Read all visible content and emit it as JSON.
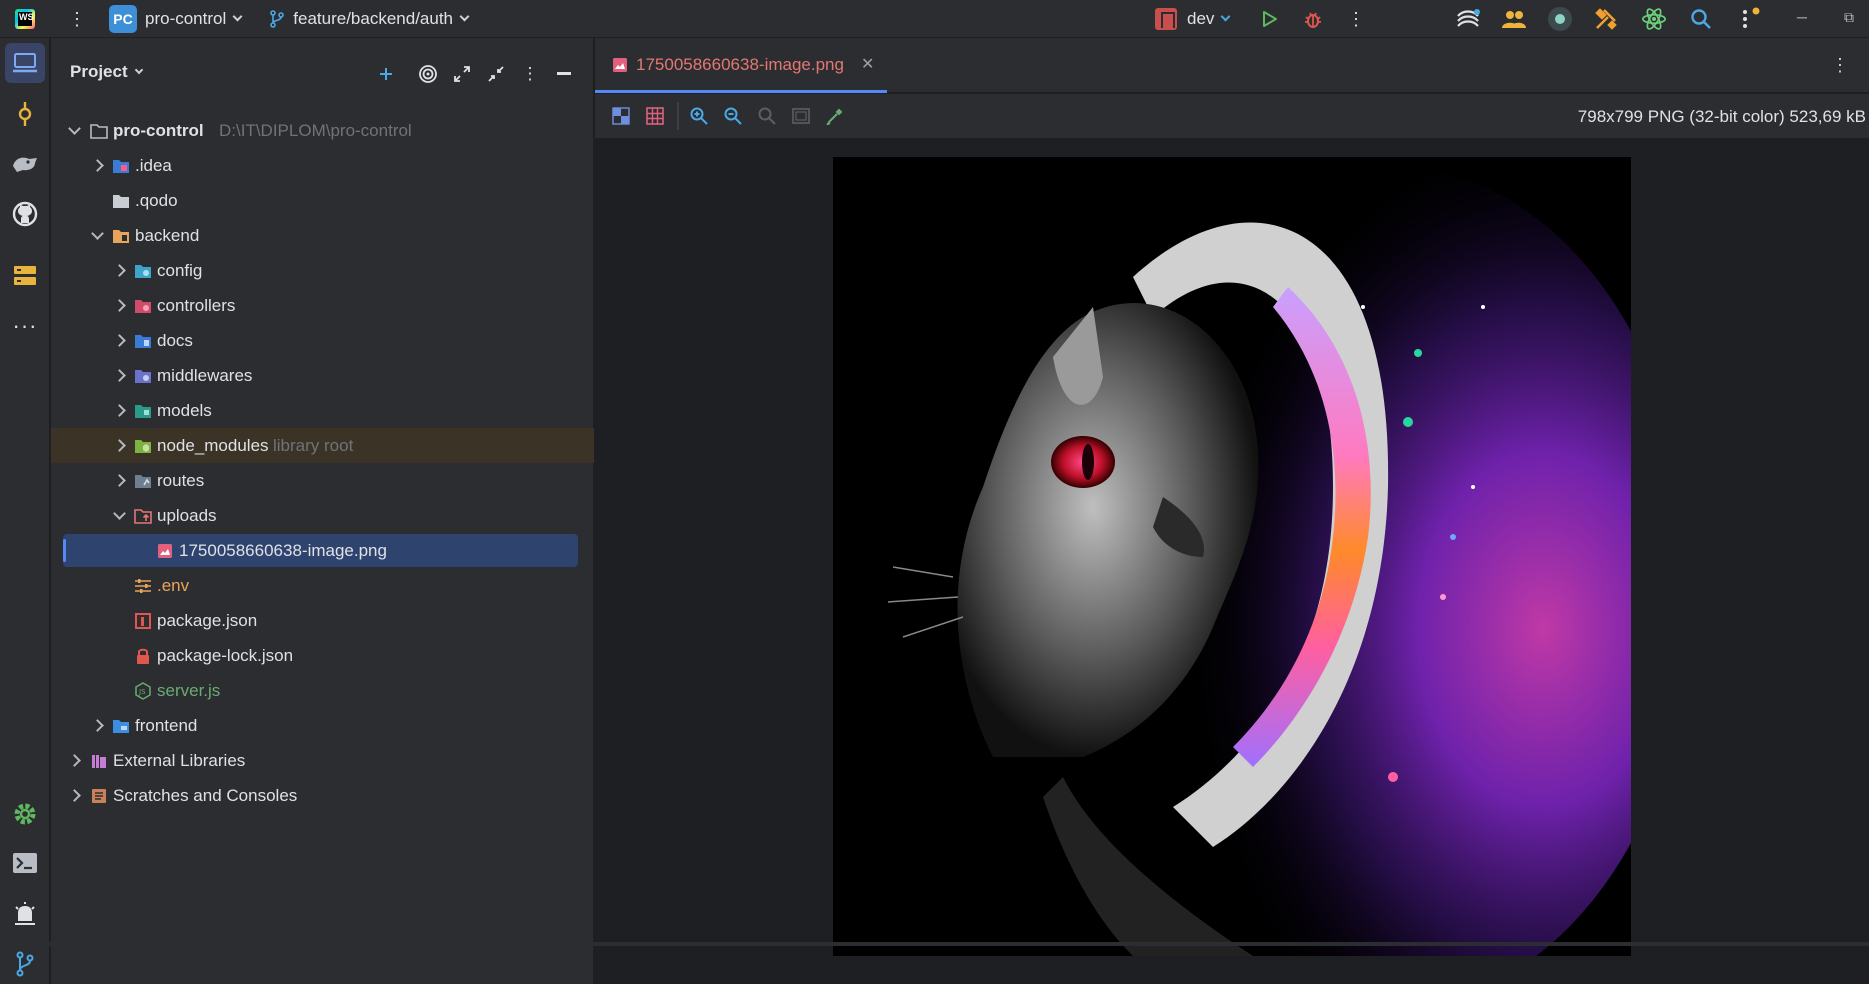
{
  "titlebar": {
    "project_badge": "PC",
    "project_name": "pro-control",
    "branch": "feature/backend/auth",
    "run_config": "dev"
  },
  "panel": {
    "title": "Project"
  },
  "tree": [
    {
      "label": "pro-control",
      "hint": "D:\\IT\\DIPLOM\\pro-control"
    },
    {
      "label": ".idea"
    },
    {
      "label": ".qodo"
    },
    {
      "label": "backend"
    },
    {
      "label": "config"
    },
    {
      "label": "controllers"
    },
    {
      "label": "docs"
    },
    {
      "label": "middlewares"
    },
    {
      "label": "models"
    },
    {
      "label": "node_modules",
      "hint": "library root"
    },
    {
      "label": "routes"
    },
    {
      "label": "uploads"
    },
    {
      "label": "1750058660638-image.png"
    },
    {
      "label": ".env"
    },
    {
      "label": "package.json"
    },
    {
      "label": "package-lock.json"
    },
    {
      "label": "server.js"
    },
    {
      "label": "frontend"
    },
    {
      "label": "External Libraries"
    },
    {
      "label": "Scratches and Consoles"
    }
  ],
  "editor": {
    "tab_label": "1750058660638-image.png",
    "image_info": "798x799 PNG (32-bit color) 523,69 kB"
  },
  "colors": {
    "accent": "#548af7",
    "selection": "#2e436e",
    "library_row": "#3c3327",
    "modified_file": "#e37774",
    "env_file": "#e9a45b",
    "js_file": "#6aab73"
  }
}
